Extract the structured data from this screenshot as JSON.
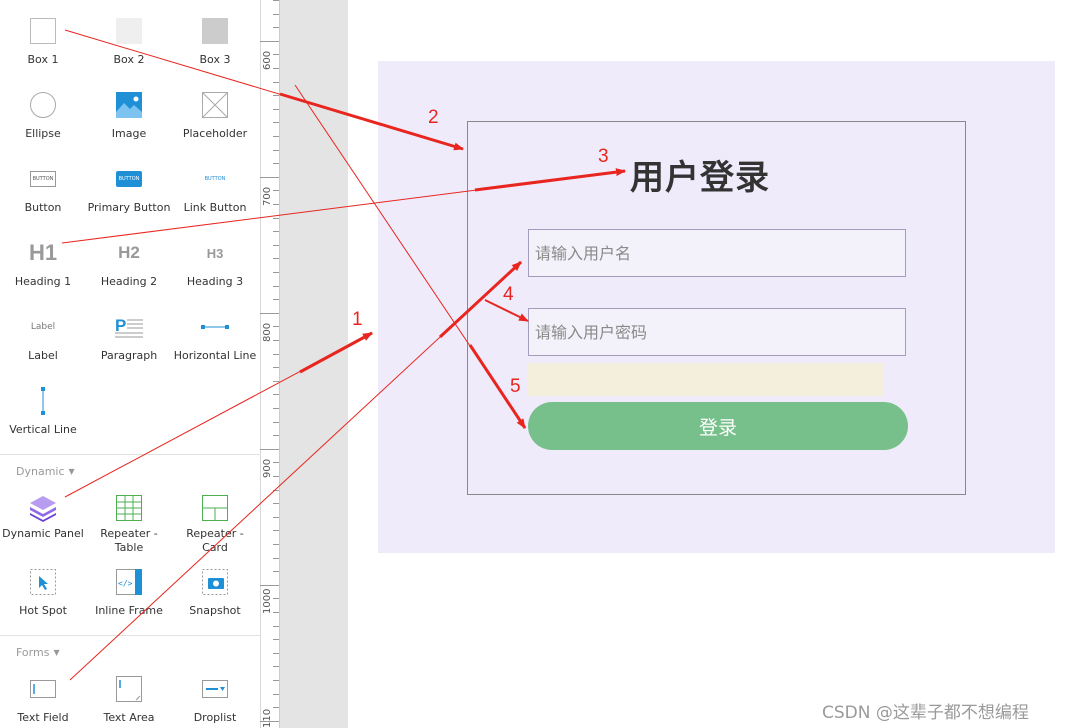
{
  "widgets": {
    "box1": "Box 1",
    "box2": "Box 2",
    "box3": "Box 3",
    "ellipse": "Ellipse",
    "image": "Image",
    "placeholder": "Placeholder",
    "button": "Button",
    "primary_button": "Primary Button",
    "link_button": "Link Button",
    "heading1": "Heading 1",
    "heading2": "Heading 2",
    "heading3": "Heading 3",
    "label": "Label",
    "paragraph": "Paragraph",
    "horizontal_line": "Horizontal Line",
    "vertical_line": "Vertical Line",
    "dynamic_panel": "Dynamic Panel",
    "repeater_table": "Repeater - Table",
    "repeater_card": "Repeater - Card",
    "hot_spot": "Hot Spot",
    "inline_frame": "Inline Frame",
    "snapshot": "Snapshot",
    "text_field": "Text Field",
    "text_area": "Text Area",
    "droplist": "Droplist"
  },
  "thumbs": {
    "button_text": "BUTTON",
    "h1": "H1",
    "h2": "H2",
    "h3": "H3",
    "label_text": "Label"
  },
  "sections": {
    "dynamic": "Dynamic",
    "forms": "Forms"
  },
  "ruler": {
    "marks": [
      "600",
      "700",
      "800",
      "900",
      "1000",
      "110"
    ]
  },
  "login": {
    "title": "用户登录",
    "username_placeholder": "请输入用户名",
    "password_placeholder": "请输入用户密码",
    "button_label": "登录"
  },
  "annotations": {
    "n1": "1",
    "n2": "2",
    "n3": "3",
    "n4": "4",
    "n5": "5"
  },
  "watermark": "CSDN @这辈子都不想编程",
  "colors": {
    "arrow": "#e8261f",
    "panel_bg": "#efebfb",
    "button_bg": "#78c08b",
    "error_bg": "#f4eedc"
  }
}
